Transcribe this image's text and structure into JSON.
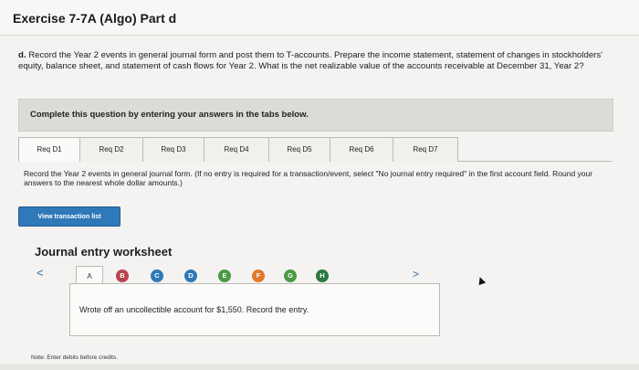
{
  "page": {
    "title": "Exercise 7-7A (Algo) Part d"
  },
  "question": {
    "label": "d.",
    "text": "Record the Year 2 events in general journal form and post them to T-accounts. Prepare the income statement, statement of changes in stockholders' equity, balance sheet, and statement of cash flows for Year 2. What is the net realizable value of the accounts receivable at December 31, Year 2?"
  },
  "banner": {
    "text": "Complete this question by entering your answers in the tabs below."
  },
  "tabs": [
    {
      "label": "Req D1"
    },
    {
      "label": "Req D2"
    },
    {
      "label": "Req D3"
    },
    {
      "label": "Req D4"
    },
    {
      "label": "Req D5"
    },
    {
      "label": "Req D6"
    },
    {
      "label": "Req D7"
    }
  ],
  "instructions": {
    "text": "Record the Year 2 events in general journal form. (If no entry is required for a transaction/event, select \"No journal entry required\" in the first account field. Round your answers to the nearest whole dollar amounts.)"
  },
  "buttons": {
    "view_transaction_list": "View transaction list"
  },
  "worksheet": {
    "title": "Journal entry worksheet",
    "nav_prev": "<",
    "nav_next": ">",
    "active_letter": "A",
    "letters": [
      "B",
      "C",
      "D",
      "E",
      "F",
      "G",
      "H"
    ],
    "entry_description": "Wrote off an uncollectible account for $1,550. Record the entry.",
    "note": "Note: Enter debits before credits."
  },
  "colors": {
    "dot_B": "#b9434e",
    "dot_C": "#2f79b8",
    "dot_D": "#2f79b8",
    "dot_E": "#4a9a45",
    "dot_F": "#e07a2c",
    "dot_G": "#4a9a45",
    "dot_H": "#2a7a3e"
  }
}
